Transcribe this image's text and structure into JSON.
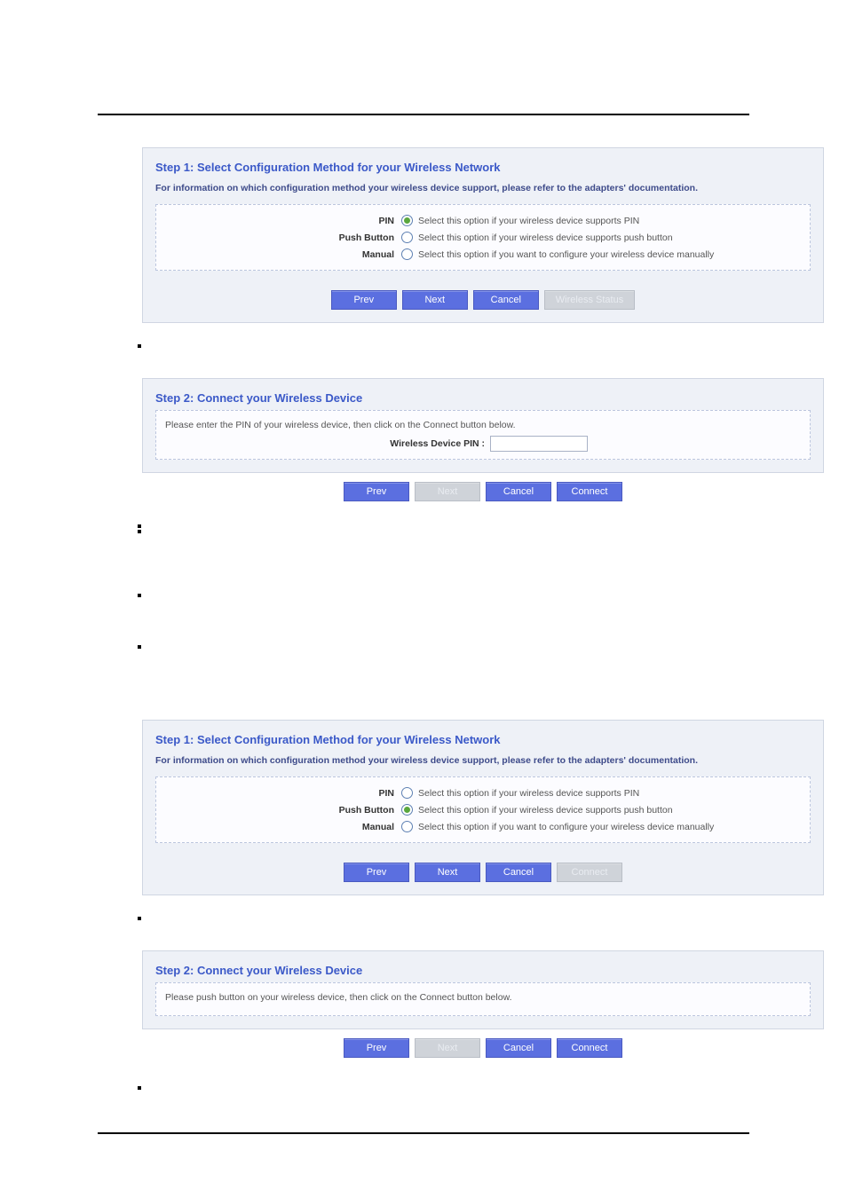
{
  "step1": {
    "title": "Step 1: Select Configuration Method for your Wireless Network",
    "subtitle": "For information on which configuration method your wireless device support, please refer to the adapters' documentation.",
    "options": [
      {
        "label": "PIN",
        "text": "Select this option if your wireless device supports PIN"
      },
      {
        "label": "Push Button",
        "text": "Select this option if your wireless device supports push button"
      },
      {
        "label": "Manual",
        "text": "Select this option if you want to configure your wireless device manually"
      }
    ]
  },
  "step2_pin": {
    "title": "Step 2: Connect your Wireless Device",
    "note": "Please enter the PIN of your wireless device, then click on the Connect button below.",
    "pin_label": "Wireless Device PIN :",
    "pin_value": ""
  },
  "step2_push": {
    "title": "Step 2: Connect your Wireless Device",
    "note": "Please push button on your wireless device, then click on the Connect button below."
  },
  "buttons": {
    "prev": "Prev",
    "next": "Next",
    "cancel": "Cancel",
    "wireless_status": "Wireless Status",
    "connect": "Connect"
  }
}
